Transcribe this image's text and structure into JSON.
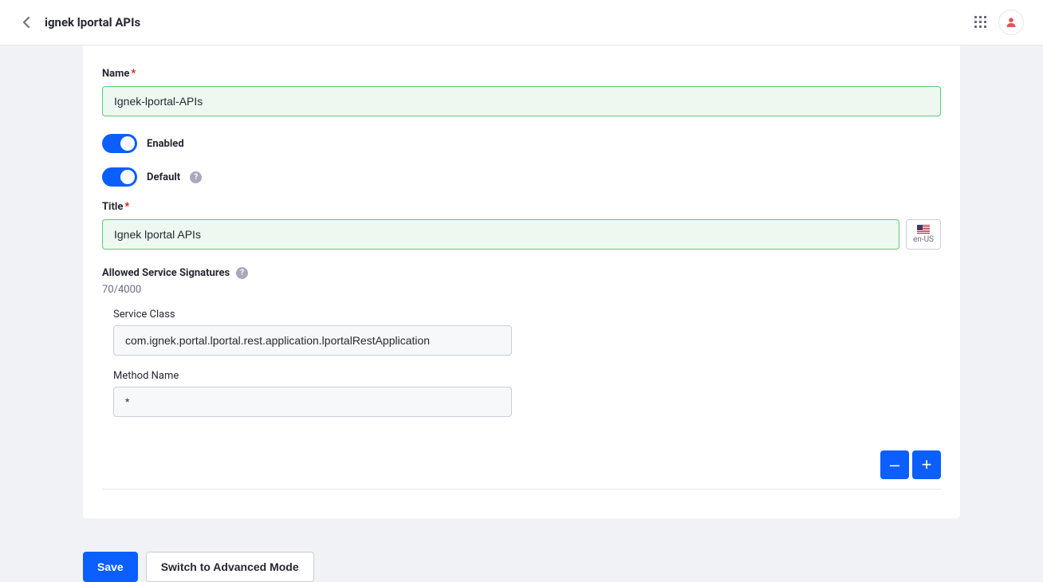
{
  "header": {
    "title": "ignek lportal APIs"
  },
  "form": {
    "name_label": "Name",
    "name_value": "Ignek-lportal-APIs",
    "enabled_label": "Enabled",
    "default_label": "Default",
    "title_label": "Title",
    "title_value": "Ignek lportal APIs",
    "locale_code": "en-US",
    "signatures_label": "Allowed Service Signatures",
    "signatures_counter": "70/4000",
    "service_class_label": "Service Class",
    "service_class_value": "com.ignek.portal.lportal.rest.application.lportalRestApplication",
    "method_name_label": "Method Name",
    "method_name_value": "*",
    "required_mark": "*"
  },
  "actions": {
    "remove": "–",
    "add": "+",
    "save": "Save",
    "advanced": "Switch to Advanced Mode"
  }
}
